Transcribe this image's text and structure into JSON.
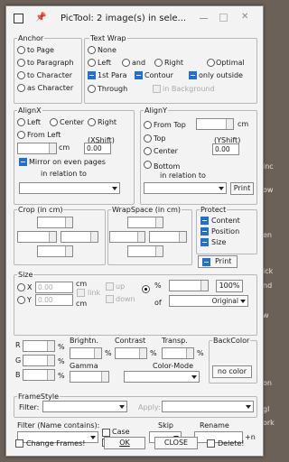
{
  "title": "PicTool: 2 image(s) in sele...",
  "background_text": [
    "inc",
    "ow",
    "en",
    "ick",
    "nd",
    "w",
    "on",
    "gl",
    "ork"
  ],
  "anchor": {
    "legend": "Anchor",
    "options": [
      "to Page",
      "to Paragraph",
      "to Character",
      "as Character"
    ]
  },
  "textwrap": {
    "legend": "Text Wrap",
    "none": "None",
    "left": "Left",
    "and": "and",
    "right": "Right",
    "optimal": "Optimal",
    "first_para": "1st Para",
    "contour": "Contour",
    "only_outside": "only outside",
    "through": "Through",
    "in_background": "in Background"
  },
  "alignx": {
    "legend": "AlignX",
    "left": "Left",
    "center": "Center",
    "right": "Right",
    "from_left": "From Left",
    "xshift": "(XShift)",
    "cm": "cm",
    "xshift_value": "0.00",
    "mirror": "Mirror on even pages",
    "in_relation": "in relation to"
  },
  "aligny": {
    "legend": "AlignY",
    "from_top": "From Top",
    "cm": "cm",
    "top": "Top",
    "yshift": "(YShift)",
    "center": "Center",
    "yshift_value": "0.00",
    "bottom": "Bottom",
    "in_relation": "in relation to",
    "print": "Print"
  },
  "crop": {
    "legend": "Crop (in cm)"
  },
  "wrapspace": {
    "legend": "WrapSpace (in cm)"
  },
  "protect": {
    "legend": "Protect",
    "content": "Content",
    "position": "Position",
    "size": "Size"
  },
  "size": {
    "legend": "Size",
    "x_label": "X",
    "y_label": "Y",
    "x_value": "0.00",
    "y_value": "0.00",
    "cm1": "cm",
    "cm2": "cm",
    "link": "link",
    "up": "up",
    "down": "down",
    "percent": "%",
    "btn_100": "100%",
    "of": "of",
    "original": "Original"
  },
  "color": {
    "r": "R",
    "g": "G",
    "b": "B",
    "pct": "%",
    "brightness": "Brightn.",
    "contrast": "Contrast",
    "transp": "Transp.",
    "gamma": "Gamma",
    "color_mode": "Color-Mode",
    "backcolor": "BackColor",
    "no_color": "no color"
  },
  "framestyle": {
    "legend": "FrameStyle",
    "filter": "Filter:",
    "apply": "Apply:"
  },
  "bottom": {
    "filter_label": "Filter (Name contains):",
    "case": "Case",
    "exclude": "exclude",
    "skip": "Skip",
    "rename": "Rename",
    "plus_n": "+n"
  },
  "footer": {
    "change_frames": "Change Frames!",
    "ok": "OK",
    "close": "CLOSE",
    "delete": "Delete!"
  }
}
